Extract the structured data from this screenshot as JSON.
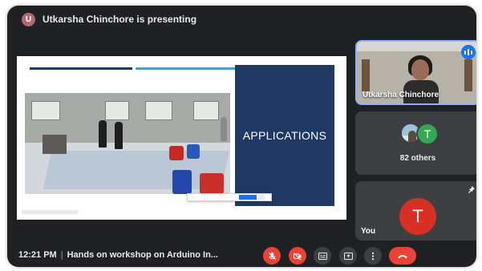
{
  "presenting": {
    "avatar_letter": "U",
    "text": "Utkarsha Chinchore is presenting"
  },
  "slide": {
    "title": "APPLICATIONS",
    "line_colors": [
      "#1f3864",
      "#4aa3c6",
      "#7f7f7f"
    ],
    "panel_color": "#1f3864"
  },
  "tiles": {
    "speaker": {
      "name": "Utkarsha Chinchore",
      "speaking": true
    },
    "others": {
      "avatar_letter": "T",
      "label": "82 others"
    },
    "self": {
      "avatar_letter": "T",
      "label": "You"
    }
  },
  "bottom_bar": {
    "time": "12:21 PM",
    "meeting_title": "Hands on workshop on Arduino In...",
    "controls": [
      "mic-off-icon",
      "camera-off-icon",
      "captions-icon",
      "present-icon",
      "more-options-icon",
      "hang-up-icon"
    ]
  },
  "colors": {
    "background": "#202124",
    "tile": "#3c4043",
    "danger": "#ea4335",
    "accent": "#1a73e8",
    "green_avatar": "#34a853"
  }
}
